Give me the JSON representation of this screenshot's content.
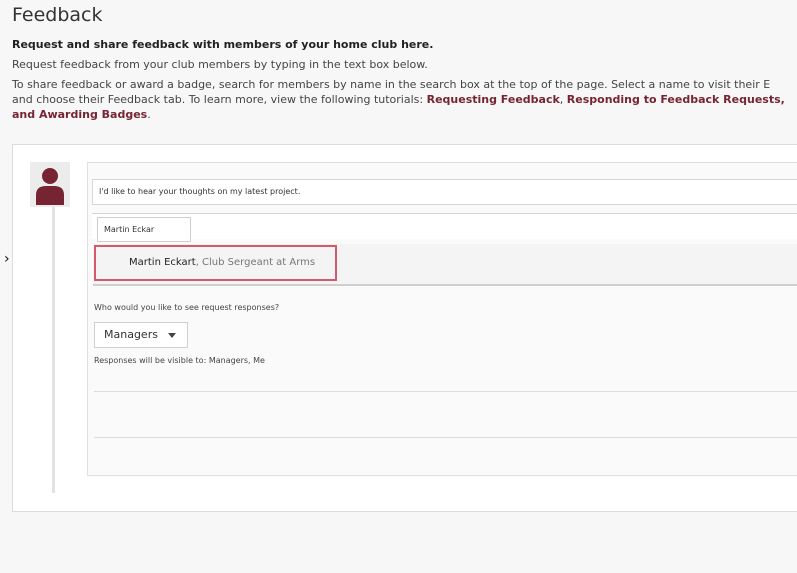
{
  "header": {
    "title": "Feedback",
    "subtitle": "Request and share feedback with members of your home club here."
  },
  "intro": {
    "line1": "Request feedback from your club members by typing in the text box below.",
    "line2": "To share feedback or award a badge, search for members by name in the search box at the top of the page. Select a name to visit their E",
    "line3_prefix": "and choose their Feedback tab. To learn more, view the following tutorials: ",
    "links": [
      "Requesting Feedback",
      "Responding to Feedback Requests,",
      "and Awarding Badges"
    ],
    "sep": ", ",
    "period": "."
  },
  "form": {
    "request_text": "I'd like to hear your thoughts on my latest project.",
    "member_query": "Martin Eckar",
    "suggestion": {
      "name": "Martin Eckart",
      "role": ", Club Sergeant at Arms"
    },
    "visibility_question": "Who would you like to see request responses?",
    "visibility_selected": "Managers",
    "visibility_note": "Responses will be visible to: Managers, Me"
  },
  "colors": {
    "accent": "#772432",
    "highlight_border": "#d35a6d"
  },
  "icons": {
    "avatar": "user-avatar-icon",
    "dropdown": "chevron-down-icon"
  }
}
